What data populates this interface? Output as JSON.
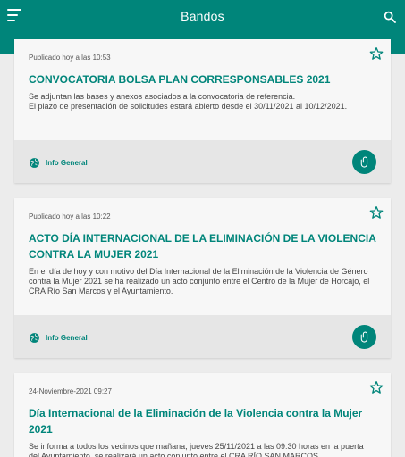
{
  "app": {
    "title": "Bandos"
  },
  "colors": {
    "primary": "#00857a",
    "card_bg": "#f7f7f7",
    "footer_bg": "#e6e6e6"
  },
  "icons": {
    "menu": "menu-icon",
    "search": "search-icon",
    "favorite": "star-outline-icon",
    "category": "globe-icon",
    "attachment": "paperclip-icon"
  },
  "posts": [
    {
      "date": "Publicado hoy a las 10:53",
      "title": "CONVOCATORIA BOLSA PLAN CORRESPONSABLES 2021",
      "description": "Se adjuntan las bases y anexos asociados a la convocatoria de referencia.\nEl plazo de presentación de solicitudes estará abierto desde el 30/11/2021 al 10/12/2021.",
      "category": "Info General"
    },
    {
      "date": "Publicado hoy a las 10:22",
      "title": "ACTO DÍA INTERNACIONAL DE LA ELIMINACIÓN DE LA VIOLENCIA CONTRA LA MUJER 2021",
      "description": "En el día de hoy y con motivo del Día Internacional de la Eliminación de la Violencia de Género contra la Mujer 2021 se ha realizado un acto conjunto entre el Centro de la Mujer de Horcajo, el CRA Río San Marcos y el Ayuntamiento.",
      "category": "Info General"
    },
    {
      "date": "24-Noviembre-2021 09:27",
      "title": "Día Internacional de la Eliminación de la Violencia contra la Mujer 2021",
      "description": "Se informa a todos los vecinos que mañana, jueves 25/11/2021 a las 09:30 horas en la puerta del Ayuntamiento, se realizará un acto conjunto entre el CRA RÍO SAN MARCOS",
      "category": ""
    }
  ]
}
